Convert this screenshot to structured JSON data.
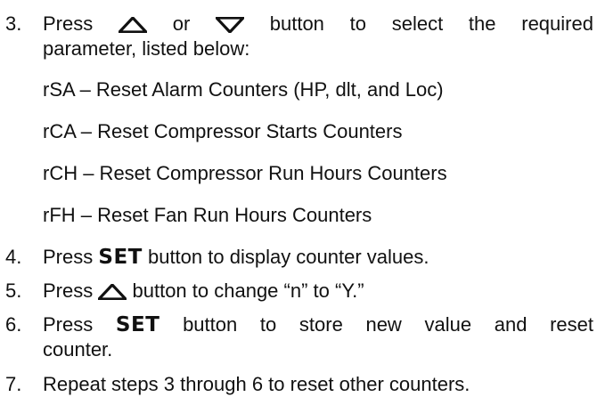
{
  "step3": {
    "num": "3.",
    "w1": "Press",
    "or": "or",
    "rest": "button to select the required",
    "line2": "parameter, listed below:"
  },
  "options": [
    "rSA – Reset Alarm Counters (HP, dlt, and Loc)",
    "rCA – Reset Compressor Starts Counters",
    "rCH – Reset Compressor Run Hours Counters",
    "rFH – Reset Fan Run Hours Counters"
  ],
  "step4": {
    "num": "4.",
    "w1": "Press",
    "set": "SET",
    "rest": "button to display counter values."
  },
  "step5": {
    "num": "5.",
    "w1": "Press",
    "rest": "button to change “n” to “Y.”"
  },
  "step6": {
    "num": "6.",
    "w1": "Press",
    "set": "SET",
    "rest": "button to store new value and reset",
    "line2": "counter."
  },
  "step7": {
    "num": "7.",
    "text": "Repeat steps 3 through 6 to reset other counters."
  },
  "icons": {
    "up": "up-arrow-icon",
    "down": "down-arrow-icon"
  }
}
